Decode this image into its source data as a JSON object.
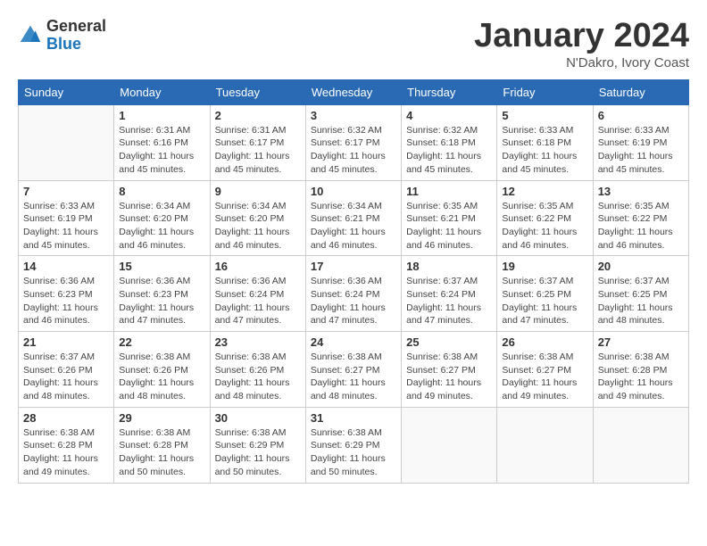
{
  "header": {
    "logo_general": "General",
    "logo_blue": "Blue",
    "month_title": "January 2024",
    "location": "N'Dakro, Ivory Coast"
  },
  "weekdays": [
    "Sunday",
    "Monday",
    "Tuesday",
    "Wednesday",
    "Thursday",
    "Friday",
    "Saturday"
  ],
  "weeks": [
    [
      {
        "day": "",
        "info": ""
      },
      {
        "day": "1",
        "info": "Sunrise: 6:31 AM\nSunset: 6:16 PM\nDaylight: 11 hours\nand 45 minutes."
      },
      {
        "day": "2",
        "info": "Sunrise: 6:31 AM\nSunset: 6:17 PM\nDaylight: 11 hours\nand 45 minutes."
      },
      {
        "day": "3",
        "info": "Sunrise: 6:32 AM\nSunset: 6:17 PM\nDaylight: 11 hours\nand 45 minutes."
      },
      {
        "day": "4",
        "info": "Sunrise: 6:32 AM\nSunset: 6:18 PM\nDaylight: 11 hours\nand 45 minutes."
      },
      {
        "day": "5",
        "info": "Sunrise: 6:33 AM\nSunset: 6:18 PM\nDaylight: 11 hours\nand 45 minutes."
      },
      {
        "day": "6",
        "info": "Sunrise: 6:33 AM\nSunset: 6:19 PM\nDaylight: 11 hours\nand 45 minutes."
      }
    ],
    [
      {
        "day": "7",
        "info": "Sunrise: 6:33 AM\nSunset: 6:19 PM\nDaylight: 11 hours\nand 45 minutes."
      },
      {
        "day": "8",
        "info": "Sunrise: 6:34 AM\nSunset: 6:20 PM\nDaylight: 11 hours\nand 46 minutes."
      },
      {
        "day": "9",
        "info": "Sunrise: 6:34 AM\nSunset: 6:20 PM\nDaylight: 11 hours\nand 46 minutes."
      },
      {
        "day": "10",
        "info": "Sunrise: 6:34 AM\nSunset: 6:21 PM\nDaylight: 11 hours\nand 46 minutes."
      },
      {
        "day": "11",
        "info": "Sunrise: 6:35 AM\nSunset: 6:21 PM\nDaylight: 11 hours\nand 46 minutes."
      },
      {
        "day": "12",
        "info": "Sunrise: 6:35 AM\nSunset: 6:22 PM\nDaylight: 11 hours\nand 46 minutes."
      },
      {
        "day": "13",
        "info": "Sunrise: 6:35 AM\nSunset: 6:22 PM\nDaylight: 11 hours\nand 46 minutes."
      }
    ],
    [
      {
        "day": "14",
        "info": "Sunrise: 6:36 AM\nSunset: 6:23 PM\nDaylight: 11 hours\nand 46 minutes."
      },
      {
        "day": "15",
        "info": "Sunrise: 6:36 AM\nSunset: 6:23 PM\nDaylight: 11 hours\nand 47 minutes."
      },
      {
        "day": "16",
        "info": "Sunrise: 6:36 AM\nSunset: 6:24 PM\nDaylight: 11 hours\nand 47 minutes."
      },
      {
        "day": "17",
        "info": "Sunrise: 6:36 AM\nSunset: 6:24 PM\nDaylight: 11 hours\nand 47 minutes."
      },
      {
        "day": "18",
        "info": "Sunrise: 6:37 AM\nSunset: 6:24 PM\nDaylight: 11 hours\nand 47 minutes."
      },
      {
        "day": "19",
        "info": "Sunrise: 6:37 AM\nSunset: 6:25 PM\nDaylight: 11 hours\nand 47 minutes."
      },
      {
        "day": "20",
        "info": "Sunrise: 6:37 AM\nSunset: 6:25 PM\nDaylight: 11 hours\nand 48 minutes."
      }
    ],
    [
      {
        "day": "21",
        "info": "Sunrise: 6:37 AM\nSunset: 6:26 PM\nDaylight: 11 hours\nand 48 minutes."
      },
      {
        "day": "22",
        "info": "Sunrise: 6:38 AM\nSunset: 6:26 PM\nDaylight: 11 hours\nand 48 minutes."
      },
      {
        "day": "23",
        "info": "Sunrise: 6:38 AM\nSunset: 6:26 PM\nDaylight: 11 hours\nand 48 minutes."
      },
      {
        "day": "24",
        "info": "Sunrise: 6:38 AM\nSunset: 6:27 PM\nDaylight: 11 hours\nand 48 minutes."
      },
      {
        "day": "25",
        "info": "Sunrise: 6:38 AM\nSunset: 6:27 PM\nDaylight: 11 hours\nand 49 minutes."
      },
      {
        "day": "26",
        "info": "Sunrise: 6:38 AM\nSunset: 6:27 PM\nDaylight: 11 hours\nand 49 minutes."
      },
      {
        "day": "27",
        "info": "Sunrise: 6:38 AM\nSunset: 6:28 PM\nDaylight: 11 hours\nand 49 minutes."
      }
    ],
    [
      {
        "day": "28",
        "info": "Sunrise: 6:38 AM\nSunset: 6:28 PM\nDaylight: 11 hours\nand 49 minutes."
      },
      {
        "day": "29",
        "info": "Sunrise: 6:38 AM\nSunset: 6:28 PM\nDaylight: 11 hours\nand 50 minutes."
      },
      {
        "day": "30",
        "info": "Sunrise: 6:38 AM\nSunset: 6:29 PM\nDaylight: 11 hours\nand 50 minutes."
      },
      {
        "day": "31",
        "info": "Sunrise: 6:38 AM\nSunset: 6:29 PM\nDaylight: 11 hours\nand 50 minutes."
      },
      {
        "day": "",
        "info": ""
      },
      {
        "day": "",
        "info": ""
      },
      {
        "day": "",
        "info": ""
      }
    ]
  ]
}
